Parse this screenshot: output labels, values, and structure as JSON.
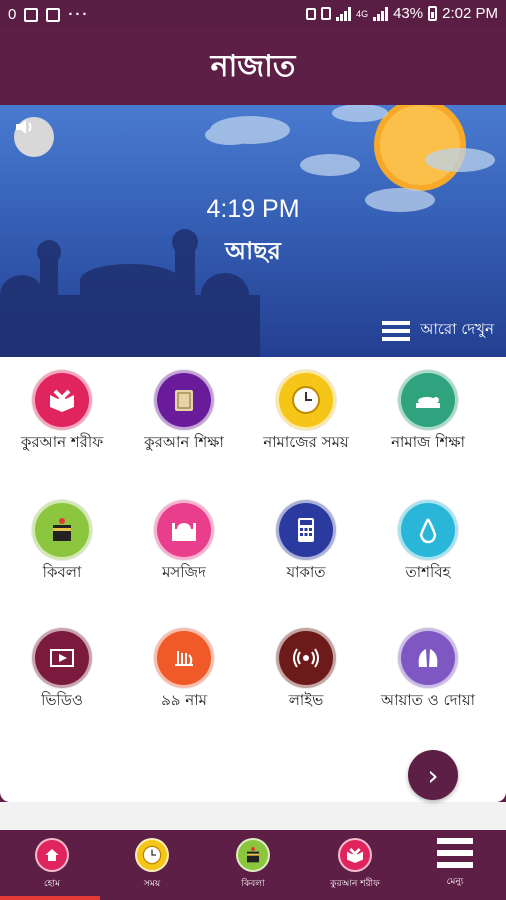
{
  "status": {
    "notification_count": "0",
    "network": "4G",
    "battery": "43%",
    "time": "2:02 PM"
  },
  "app": {
    "title": "নাজাত"
  },
  "hero": {
    "current_time": "4:19 PM",
    "prayer_name": "আছর",
    "see_more": "আরো দেখুন"
  },
  "grid": [
    {
      "label": "কুরআন শরীফ",
      "icon": "quran-open-icon",
      "color": "#e0245e"
    },
    {
      "label": "কুরআন শিক্ষা",
      "icon": "quran-book-icon",
      "color": "#6a1b9a"
    },
    {
      "label": "নামাজের সময়",
      "icon": "clock-icon",
      "color": "#f5c518"
    },
    {
      "label": "নামাজ শিক্ষা",
      "icon": "prayer-icon",
      "color": "#2fa37d"
    },
    {
      "label": "কিবলা",
      "icon": "kaaba-icon",
      "color": "#8cc63f"
    },
    {
      "label": "মসজিদ",
      "icon": "mosque-icon",
      "color": "#e83e8c"
    },
    {
      "label": "যাকাত",
      "icon": "calculator-icon",
      "color": "#2b3a9e"
    },
    {
      "label": "তাশবিহ",
      "icon": "tasbih-icon",
      "color": "#29b6d8"
    },
    {
      "label": "ভিডিও",
      "icon": "video-icon",
      "color": "#7a1b3d"
    },
    {
      "label": "৯৯ নাম",
      "icon": "allah-icon",
      "color": "#f05a28"
    },
    {
      "label": "লাইভ",
      "icon": "live-icon",
      "color": "#6d1a1a"
    },
    {
      "label": "আয়াত ও দোয়া",
      "icon": "dua-hands-icon",
      "color": "#7e57c2"
    }
  ],
  "bottom_nav": [
    {
      "label": "হোম",
      "icon": "home-icon",
      "color": "#e0245e"
    },
    {
      "label": "সময়",
      "icon": "clock-icon",
      "color": "#f5c518"
    },
    {
      "label": "কিবলা",
      "icon": "kaaba-icon",
      "color": "#8cc63f"
    },
    {
      "label": "কুরআন শরীফ",
      "icon": "quran-open-icon",
      "color": "#e0245e"
    },
    {
      "label": "মেন্যু",
      "icon": "menu-icon",
      "color": "#ffffff"
    }
  ]
}
